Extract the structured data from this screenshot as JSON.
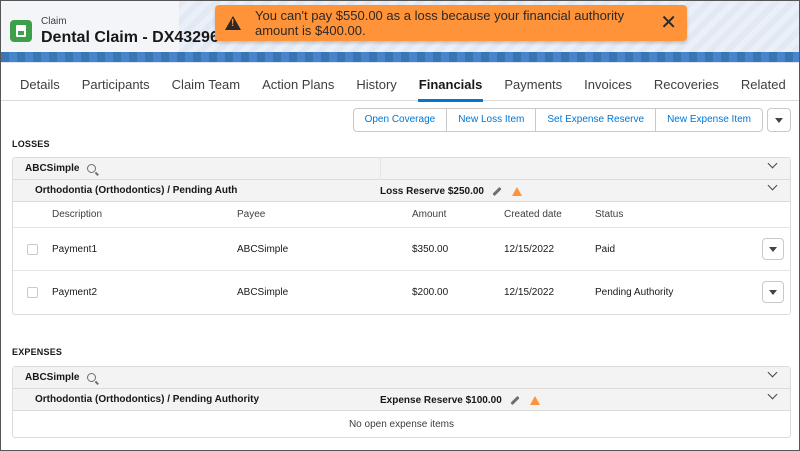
{
  "header": {
    "object_type": "Claim",
    "title": "Dental Claim - DX43296"
  },
  "toast": {
    "message": "You can't pay $550.00 as a loss because your financial authority amount is $400.00.",
    "color": "#fe9339"
  },
  "tabs": [
    {
      "label": "Details"
    },
    {
      "label": "Participants"
    },
    {
      "label": "Claim Team"
    },
    {
      "label": "Action Plans"
    },
    {
      "label": "History"
    },
    {
      "label": "Financials",
      "active": true
    },
    {
      "label": "Payments"
    },
    {
      "label": "Invoices"
    },
    {
      "label": "Recoveries"
    },
    {
      "label": "Related"
    }
  ],
  "actions": {
    "open_coverage": "Open Coverage",
    "new_loss_item": "New Loss Item",
    "set_expense_reserve": "Set Expense Reserve",
    "new_expense_item": "New Expense Item"
  },
  "losses": {
    "section_title": "LOSSES",
    "payee_group": "ABCSimple",
    "coverage": "Orthodontia (Orthodontics) / Pending Auth",
    "reserve": "Loss Reserve $250.00",
    "columns": {
      "description": "Description",
      "payee": "Payee",
      "amount": "Amount",
      "created_date": "Created date",
      "status": "Status"
    },
    "rows": [
      {
        "description": "Payment1",
        "payee": "ABCSimple",
        "amount": "$350.00",
        "created_date": "12/15/2022",
        "status": "Paid"
      },
      {
        "description": "Payment2",
        "payee": "ABCSimple",
        "amount": "$200.00",
        "created_date": "12/15/2022",
        "status": "Pending Authority"
      }
    ]
  },
  "expenses": {
    "section_title": "EXPENSES",
    "payee_group": "ABCSimple",
    "coverage": "Orthodontia (Orthodontics) / Pending Authority",
    "reserve": "Expense Reserve $100.00",
    "empty_text": "No open expense items"
  },
  "colors": {
    "accent": "#0176d3",
    "warning": "#fe9339",
    "claim_icon": "#3c9f4a"
  }
}
